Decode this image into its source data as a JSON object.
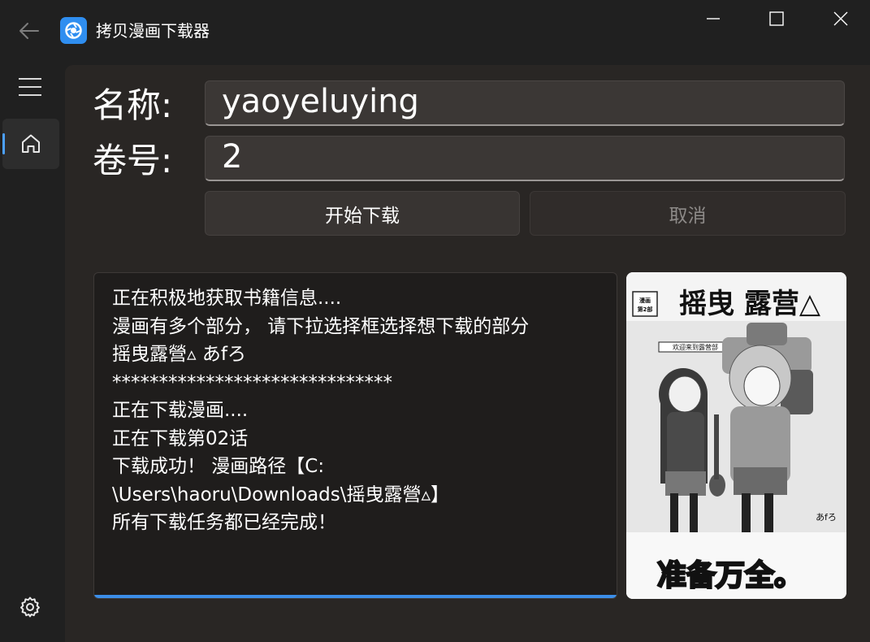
{
  "window": {
    "title": "拷贝漫画下载器",
    "accent_color": "#4ca0ff",
    "app_icon_color": "#2f8ef0"
  },
  "titlebar_icons": {
    "back": "back-arrow-icon",
    "minimize": "minimize-icon",
    "maximize": "maximize-icon",
    "close": "close-icon"
  },
  "nav": {
    "menu_icon": "hamburger-icon",
    "home_icon": "home-icon",
    "settings_icon": "gear-icon"
  },
  "form": {
    "name_label": "名称:",
    "name_value": "yaoyeluying",
    "volume_label": "卷号:",
    "volume_value": "2",
    "start_button": "开始下载",
    "cancel_button": "取消"
  },
  "log": {
    "lines": [
      "正在积极地获取书籍信息....",
      "漫画有多个部分， 请下拉选择框选择想下载的部分",
      "摇曳露營▵ あfろ",
      "******************************",
      "正在下载漫画....",
      "正在下载第02话",
      "下载成功！ 漫画路径【C:",
      "\\Users\\haoru\\Downloads\\摇曳露營▵】",
      "所有下载任务都已经完成！"
    ],
    "progress": 1.0
  },
  "cover": {
    "title": "摇曳 露营△",
    "badge": "漫画第2部",
    "subtitle": "欢迎来到露营部",
    "author": "あfろ",
    "tagline": "准备万全。"
  }
}
